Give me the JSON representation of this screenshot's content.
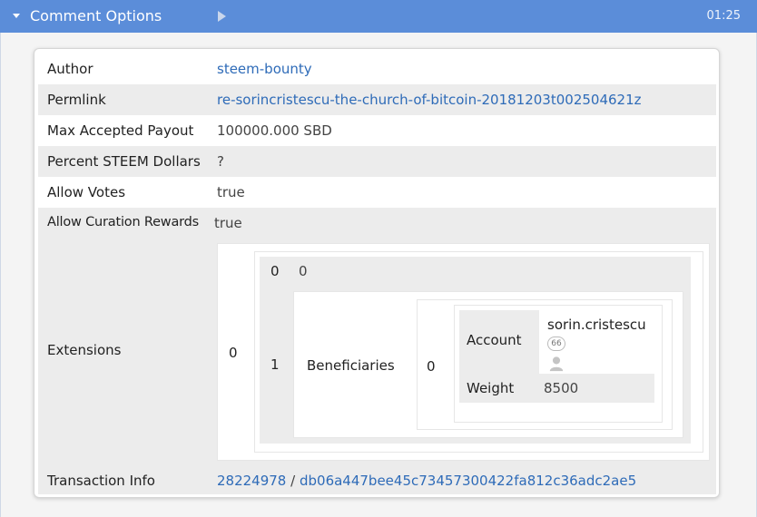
{
  "header": {
    "title": "Comment Options",
    "time": "01:25"
  },
  "rows": {
    "author": {
      "key": "Author",
      "value": "steem-bounty"
    },
    "permlink": {
      "key": "Permlink",
      "value": "re-sorincristescu-the-church-of-bitcoin-20181203t002504621z"
    },
    "max_payout": {
      "key": "Max Accepted Payout",
      "value": "100000.000 SBD"
    },
    "percent_sd": {
      "key": "Percent STEEM Dollars",
      "value": "?"
    },
    "allow_votes": {
      "key": "Allow Votes",
      "value": "true"
    },
    "allow_curation": {
      "key": "Allow Curation Rewards",
      "value": "true"
    },
    "extensions": {
      "key": "Extensions",
      "index0": "0",
      "inner": {
        "r0_index": "0",
        "r0_value": "0",
        "r1_index": "1",
        "beneficiaries_key": "Beneficiaries",
        "ben_index": "0",
        "account_key": "Account",
        "account_value": "sorin.cristescu",
        "reputation": "66",
        "weight_key": "Weight",
        "weight_value": "8500"
      }
    },
    "tx": {
      "key": "Transaction Info",
      "block": "28224978",
      "sep": "/",
      "hash": "db06a447bee45c73457300422fa812c36adc2ae5"
    }
  }
}
